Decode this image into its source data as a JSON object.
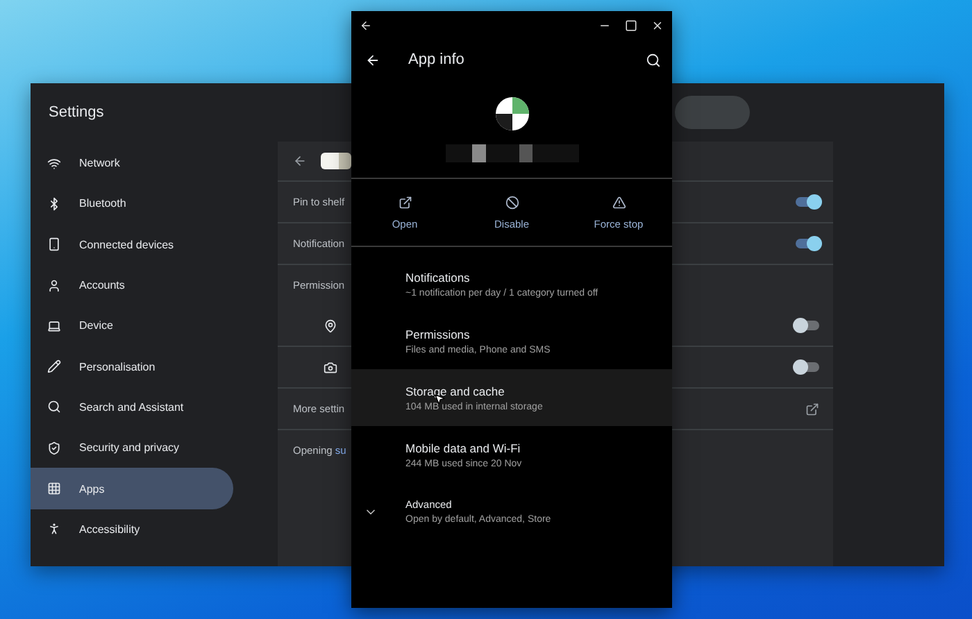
{
  "settings_window": {
    "title": "Settings",
    "sidebar": {
      "items": [
        {
          "label": "Network",
          "selected": false
        },
        {
          "label": "Bluetooth",
          "selected": false
        },
        {
          "label": "Connected devices",
          "selected": false
        },
        {
          "label": "Accounts",
          "selected": false
        },
        {
          "label": "Device",
          "selected": false
        },
        {
          "label": "Personalisation",
          "selected": false
        },
        {
          "label": "Search and Assistant",
          "selected": false
        },
        {
          "label": "Security and privacy",
          "selected": false
        },
        {
          "label": "Apps",
          "selected": true
        },
        {
          "label": "Accessibility",
          "selected": false
        }
      ]
    },
    "content": {
      "rows": [
        {
          "kind": "toggle",
          "label": "Pin to shelf",
          "on": true
        },
        {
          "kind": "toggle",
          "label": "Notification",
          "on": true
        },
        {
          "kind": "header",
          "label": "Permission"
        },
        {
          "kind": "location",
          "on": false
        },
        {
          "kind": "camera",
          "on": false
        },
        {
          "kind": "link",
          "label": "More settin"
        },
        {
          "kind": "opening",
          "label": "Opening",
          "link": "su"
        }
      ]
    }
  },
  "app_window": {
    "title": "App info",
    "actions": [
      {
        "label": "Open"
      },
      {
        "label": "Disable"
      },
      {
        "label": "Force stop"
      }
    ],
    "items": [
      {
        "title": "Notifications",
        "subtitle": "~1 notification per day / 1 category turned off",
        "highlighted": false,
        "expandable": false
      },
      {
        "title": "Permissions",
        "subtitle": "Files and media, Phone and SMS",
        "highlighted": false,
        "expandable": false
      },
      {
        "title": "Storage and cache",
        "subtitle": "104 MB used in internal storage",
        "highlighted": true,
        "expandable": false
      },
      {
        "title": "Mobile data and Wi-Fi",
        "subtitle": "244 MB used since 20 Nov",
        "highlighted": false,
        "expandable": false
      },
      {
        "title": "Advanced",
        "subtitle": "Open by default, Advanced, Store",
        "highlighted": false,
        "expandable": true
      }
    ]
  }
}
